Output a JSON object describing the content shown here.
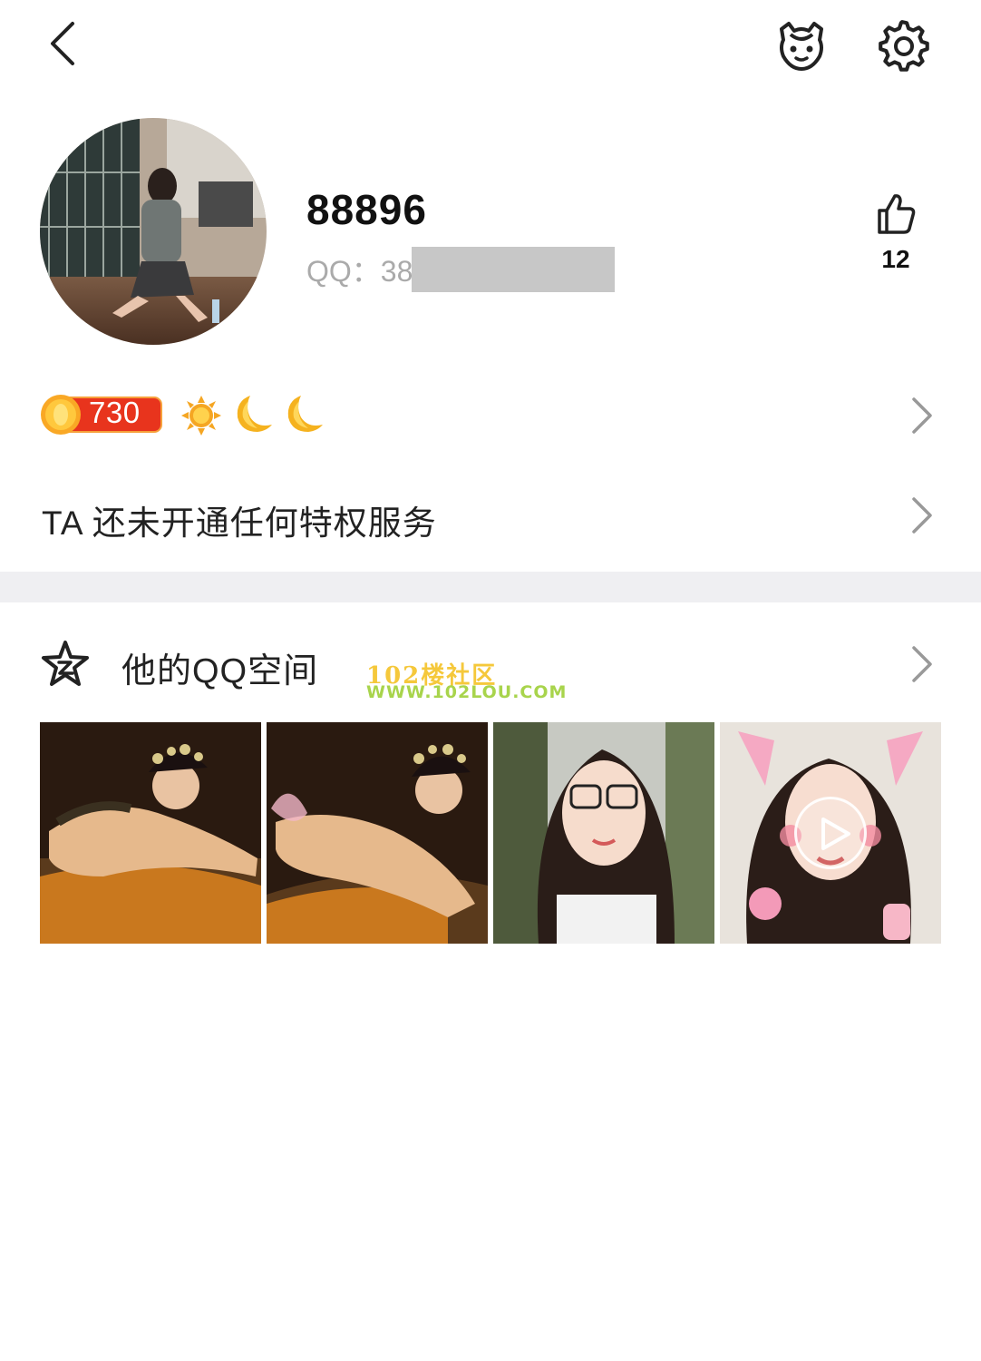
{
  "header": {
    "back_icon": "back-chevron-icon",
    "pet_icon": "pet-face-icon",
    "settings_icon": "gear-icon"
  },
  "profile": {
    "nickname": "88896",
    "qq_label": "QQ：38",
    "likes": "12",
    "like_icon": "thumbs-up-icon"
  },
  "level": {
    "value": "730",
    "badges": [
      "sun-icon",
      "moon-icon",
      "moon-icon"
    ],
    "accent": "#f5a623"
  },
  "privilege": {
    "text": "TA 还未开通任何特权服务"
  },
  "qzone": {
    "title": "他的QQ空间",
    "watermark_line1": "102楼社区",
    "watermark_line2": "WWW.102LOU.COM",
    "photos": [
      {
        "type": "image"
      },
      {
        "type": "image"
      },
      {
        "type": "image"
      },
      {
        "type": "video"
      }
    ]
  },
  "colors": {
    "section_gap": "#efeff2",
    "secondary_text": "#aaaaaa",
    "level_badge": "#e8341d"
  }
}
